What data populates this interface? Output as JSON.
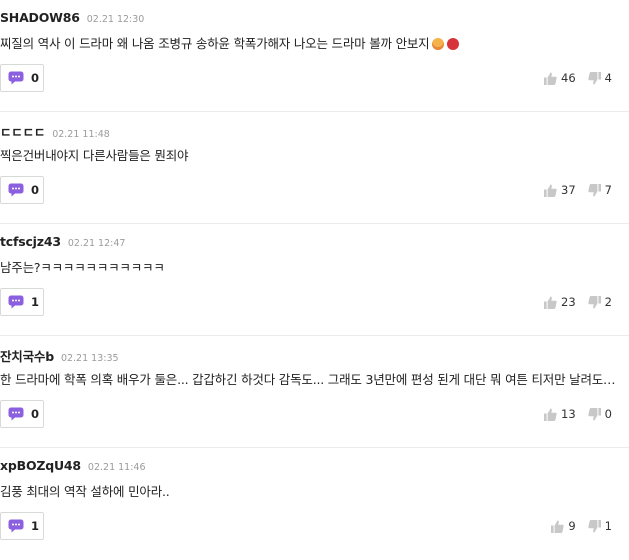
{
  "comments": [
    {
      "author": "SHADOW86",
      "time": "02.21 12:30",
      "text": "찌질의 역사 이 드라마 왜 나옴 조병규 송하윤 학폭가해자 나오는 드라마 볼까 안보지",
      "emojis": [
        "hot-face-emoji",
        "angry-face-emoji"
      ],
      "replies": "0",
      "likes": "46",
      "dislikes": "4"
    },
    {
      "author": "ㄷㄷㄷㄷ",
      "time": "02.21 11:48",
      "text": "찍은건버내야지 다른사람들은 뭔죄야",
      "replies": "0",
      "likes": "37",
      "dislikes": "7"
    },
    {
      "author": "tcfscjz43",
      "time": "02.21 12:47",
      "text": "남주는?ㅋㅋㅋㅋㅋㅋㅋㅋㅋㅋㅋ",
      "replies": "1",
      "likes": "23",
      "dislikes": "2"
    },
    {
      "author": "잔치국수b",
      "time": "02.21 13:35",
      "text": "한 드라마에 학폭 의혹 배우가 둘은... 갑갑하긴 하것다 감독도... 그래도 3년만에 편성 된게 대단 뭐 여튼 티저만 날려도 결말은 뻔하지",
      "replies": "0",
      "likes": "13",
      "dislikes": "0"
    },
    {
      "author": "xpBOZqU48",
      "time": "02.21 11:46",
      "text": "김풍 최대의 역작 설하에 민아라..",
      "replies": "1",
      "likes": "9",
      "dislikes": "1"
    }
  ],
  "colors": {
    "reply_icon": "#8c5fe0",
    "vote_icon": "#c8c8c8",
    "time_text": "#9b9b9b",
    "divider": "#ebebeb"
  }
}
